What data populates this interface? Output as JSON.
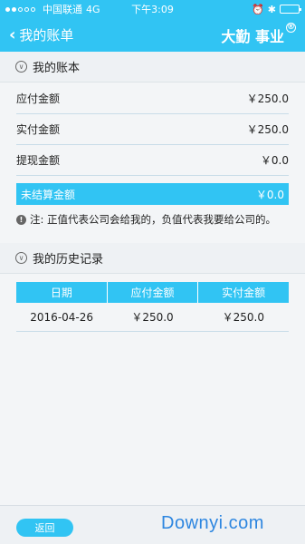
{
  "status_bar": {
    "carrier": "中国联通",
    "network": "4G",
    "time": "下午3:09",
    "battery_level": 0.9
  },
  "nav": {
    "back_label": "我的账单",
    "brand": "大勤 事业",
    "brand_mark": "®"
  },
  "bill": {
    "section_title": "我的账本",
    "rows": [
      {
        "label": "应付金额",
        "value": "￥250.0"
      },
      {
        "label": "实付金额",
        "value": "￥250.0"
      },
      {
        "label": "提现金额",
        "value": "￥0.0"
      }
    ],
    "unsettled": {
      "label": "未结算金额",
      "value": "￥0.0"
    },
    "note": "注:   正值代表公司会给我的，负值代表我要给公司的。"
  },
  "history": {
    "section_title": "我的历史记录",
    "columns": [
      "日期",
      "应付金额",
      "实付金额"
    ],
    "rows": [
      [
        "2016-04-26",
        "￥250.0",
        "￥250.0"
      ]
    ]
  },
  "footer": {
    "back_button": "返回",
    "watermark": "Downyi.com"
  },
  "colors": {
    "accent": "#31c4f3",
    "section_bg": "#eef1f4",
    "page_bg": "#f3f5f7"
  },
  "icons": [
    "chevron-left-icon",
    "chevron-down-circle-icon",
    "info-icon",
    "alarm-icon",
    "bluetooth-icon",
    "battery-icon",
    "signal-dots-icon",
    "registered-mark-icon"
  ]
}
